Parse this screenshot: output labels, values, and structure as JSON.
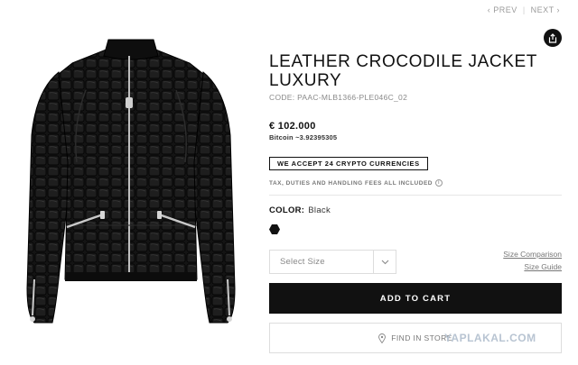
{
  "nav": {
    "prev": "PREV",
    "next": "NEXT",
    "separator": "|"
  },
  "share": {
    "icon": "share-icon"
  },
  "product": {
    "title": "LEATHER CROCODILE JACKET LUXURY",
    "code": "CODE: PAAC-MLB1366-PLE046C_02",
    "price": "€ 102.000",
    "bitcoin": "Bitcoin ~3.92395305",
    "crypto_badge": "WE ACCEPT 24 CRYPTO CURRENCIES",
    "taxes": "TAX, DUTIES AND HANDLING FEES ALL INCLUDED",
    "color_label": "COLOR:",
    "color_value": "Black",
    "swatch_color": "#111111"
  },
  "size": {
    "select_placeholder": "Select Size",
    "comparison_link": "Size Comparison",
    "guide_link": "Size Guide"
  },
  "actions": {
    "add_to_cart": "ADD TO CART",
    "find_in_store": "FIND IN STORE"
  },
  "watermark": "YAPLAKAL.COM"
}
